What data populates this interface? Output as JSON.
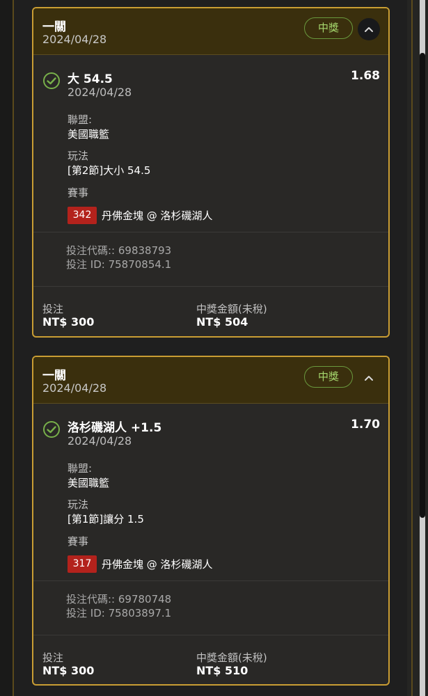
{
  "cards": [
    {
      "bet_type": "一關",
      "date": "2024/04/28",
      "status": "中獎",
      "selection": {
        "title": "大 54.5",
        "date": "2024/04/28",
        "odds": "1.68"
      },
      "league_label": "聯盟:",
      "league": "美國職籃",
      "market_label": "玩法",
      "market": "[第2節]大小 54.5",
      "event_label": "賽事",
      "event_id": "342",
      "event_name": "丹佛金塊 @ 洛杉磯湖人",
      "bet_code": "投注代碼:: 69838793",
      "bet_id": "投注 ID: 75870854.1",
      "stake_label": "投注",
      "stake": "NT$ 300",
      "payout_label": "中獎金額(未稅)",
      "payout": "NT$ 504"
    },
    {
      "bet_type": "一關",
      "date": "2024/04/28",
      "status": "中獎",
      "selection": {
        "title": "洛杉磯湖人 +1.5",
        "date": "2024/04/28",
        "odds": "1.70"
      },
      "league_label": "聯盟:",
      "league": "美國職籃",
      "market_label": "玩法",
      "market": "[第1節]讓分 1.5",
      "event_label": "賽事",
      "event_id": "317",
      "event_name": "丹佛金塊 @ 洛杉磯湖人",
      "bet_code": "投注代碼:: 69780748",
      "bet_id": "投注 ID: 75803897.1",
      "stake_label": "投注",
      "stake": "NT$ 300",
      "payout_label": "中獎金額(未稅)",
      "payout": "NT$ 510"
    }
  ],
  "icons": {
    "check": "check-circle-icon",
    "collapse": "chevron-up-icon"
  },
  "colors": {
    "accent_gold": "#c99d33",
    "win_green": "#a6d86e",
    "event_badge_red": "#b3221c"
  }
}
